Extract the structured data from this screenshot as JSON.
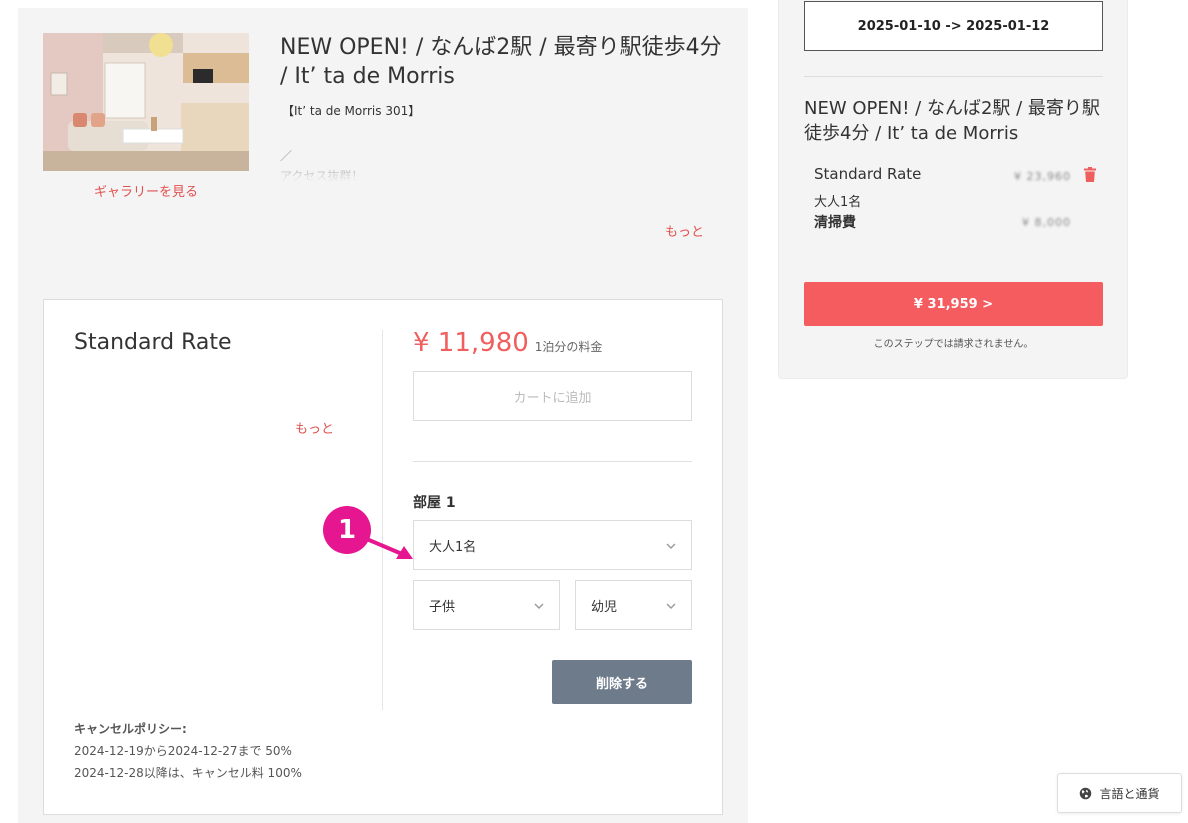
{
  "listing": {
    "title": "NEW OPEN! / なんば2駅 / 最寄り駅徒歩4分 / It’ ta de Morris",
    "subtitle": "【It’ ta de Morris 301】",
    "desc_line1": "／",
    "desc_line2": "アクセス抜群！",
    "gallery_link": "ギャラリーを見る",
    "more_link": "もっと"
  },
  "rate": {
    "name": "Standard Rate",
    "more_link": "もっと",
    "price": "¥ 11,980",
    "price_unit": "1泊分の料金",
    "add_to_cart": "カートに追加",
    "room_label": "部屋 1",
    "adults": "大人1名",
    "children": "子供",
    "infants": "幼児",
    "delete_button": "削除する",
    "cancel_policy_title": "キャンセルポリシー:",
    "cancel_policy_line1": "2024-12-19から2024-12-27まで 50%",
    "cancel_policy_line2": "2024-12-28以降は、キャンセル料 100%"
  },
  "annotation": {
    "step": "1",
    "color": "#e5168f"
  },
  "cart": {
    "dates": "2025-01-10 -> 2025-01-12",
    "title": "NEW OPEN! / なんば2駅 / 最寄り駅徒歩4分 / It’ ta de Morris",
    "item_name": "Standard Rate",
    "item_guests": "大人1名",
    "item_price": "¥ 23,960",
    "fee_label": "清掃費",
    "fee_price": "¥ 8,000",
    "total_button": "¥ 31,959 >",
    "no_charge_note": "このステップでは請求されません。"
  },
  "footer": {
    "language_button": "言語と通貨"
  },
  "colors": {
    "accent": "#f15e5e",
    "total_button": "#f55c60",
    "delete_button": "#6e7b8b",
    "annotation": "#e5168f"
  },
  "icons": [
    "chevron-down-icon",
    "trash-icon",
    "globe-icon"
  ]
}
